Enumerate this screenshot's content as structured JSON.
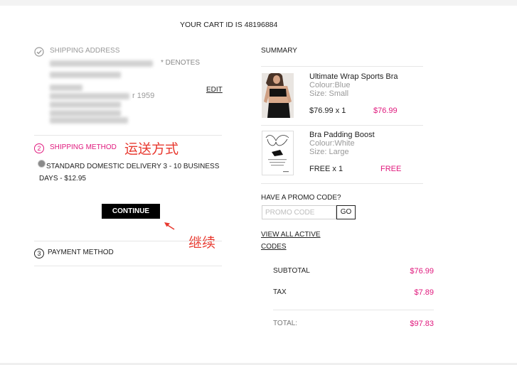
{
  "header": {
    "cart_id": "YOUR CART ID IS 48196884"
  },
  "shipping_address": {
    "icon": "check-circle-icon",
    "title": "SHIPPING ADDRESS",
    "required_note": "* DENOTES",
    "address_fragment": "r 1959",
    "edit_label": "EDIT"
  },
  "shipping_method": {
    "step_number": "2",
    "title": "SHIPPING METHOD",
    "annotation": "运送方式",
    "option_icon": "radio-selected-icon",
    "option_label": "STANDARD DOMESTIC DELIVERY 3 - 10 BUSINESS DAYS - $12.95",
    "option_selected": true,
    "continue_label": "CONTINUE",
    "arrow_icon": "arrow-annotation-icon",
    "continue_annotation": "继续"
  },
  "payment_method": {
    "step_number": "3",
    "title": "PAYMENT METHOD"
  },
  "summary": {
    "title": "SUMMARY",
    "items": [
      {
        "name": "Ultimate Wrap Sports Bra",
        "colour": "Colour:Blue",
        "size": "Size: Small",
        "qty_price": "$76.99 x 1",
        "line_total": "$76.99"
      },
      {
        "name": "Bra Padding Boost",
        "colour": "Colour:White",
        "size": "Size: Large",
        "qty_price": "FREE x 1",
        "line_total": "FREE"
      }
    ],
    "promo": {
      "label": "HAVE A PROMO CODE?",
      "placeholder": "PROMO CODE",
      "go_label": "GO",
      "view_codes_label": "VIEW ALL ACTIVE CODES"
    },
    "totals": [
      {
        "label": "SUBTOTAL",
        "value": "$76.99"
      },
      {
        "label": "TAX",
        "value": "$7.89"
      },
      {
        "label": "TOTAL:",
        "value": "$97.83"
      }
    ]
  },
  "colors": {
    "accent": "#e0197d",
    "annotation": "#e8392f",
    "muted": "#999999",
    "text": "#222222",
    "button": "#000000"
  }
}
